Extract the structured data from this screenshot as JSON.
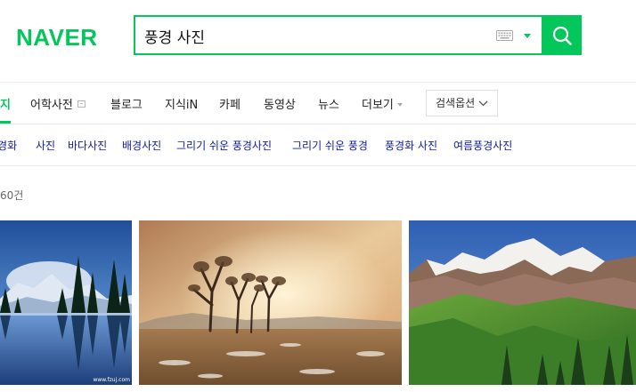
{
  "logo": {
    "text": "NAVER"
  },
  "search": {
    "query": "풍경 사진"
  },
  "tabs": [
    {
      "label": "지",
      "active": true
    },
    {
      "label": "어학사전",
      "has_icon": true
    },
    {
      "label": "블로그"
    },
    {
      "label": "지식iN"
    },
    {
      "label": "카페"
    },
    {
      "label": "동영상"
    },
    {
      "label": "뉴스"
    },
    {
      "label": "더보기",
      "has_caret": true
    }
  ],
  "search_options": {
    "label": "검색옵션"
  },
  "related": [
    "풍경화",
    "사진",
    "바다사진",
    "배경사진",
    "그리기 쉬운 풍경사진",
    "그리기 쉬운 풍경",
    "풍경화 사진",
    "여름풍경사진"
  ],
  "result_count": "60건",
  "images": [
    {
      "icon": "lake-reflection-image",
      "watermark": "www.fzuj.com"
    },
    {
      "icon": "autumn-trees-image"
    },
    {
      "icon": "mountain-meadow-image"
    }
  ],
  "colors": {
    "brand": "#03c75a",
    "related_link": "#0f1e9b"
  }
}
